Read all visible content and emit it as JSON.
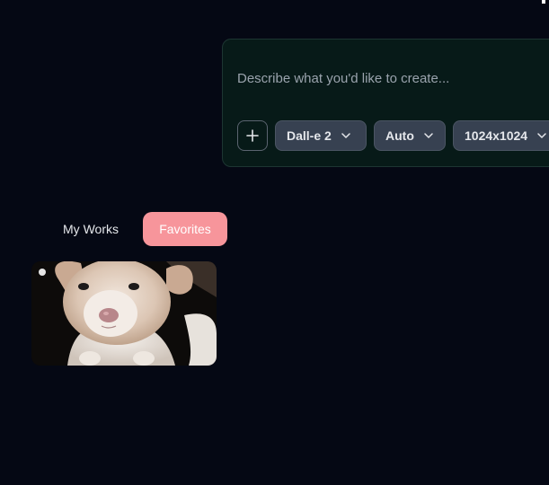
{
  "prompt": {
    "placeholder": "Describe what you'd like to create...",
    "value": ""
  },
  "controls": {
    "add_icon": "plus-icon",
    "model_label": "Dall-e 2",
    "quality_label": "Auto",
    "size_label": "1024x1024",
    "chevron_icon": "chevron-down-icon"
  },
  "tabs": [
    {
      "label": "My Works",
      "active": false
    },
    {
      "label": "Favorites",
      "active": true
    }
  ],
  "colors": {
    "background": "#050814",
    "panel": "#071a18",
    "accent": "#f7959b"
  },
  "gallery": {
    "items": [
      {
        "subject": "puppy-photo"
      }
    ]
  }
}
